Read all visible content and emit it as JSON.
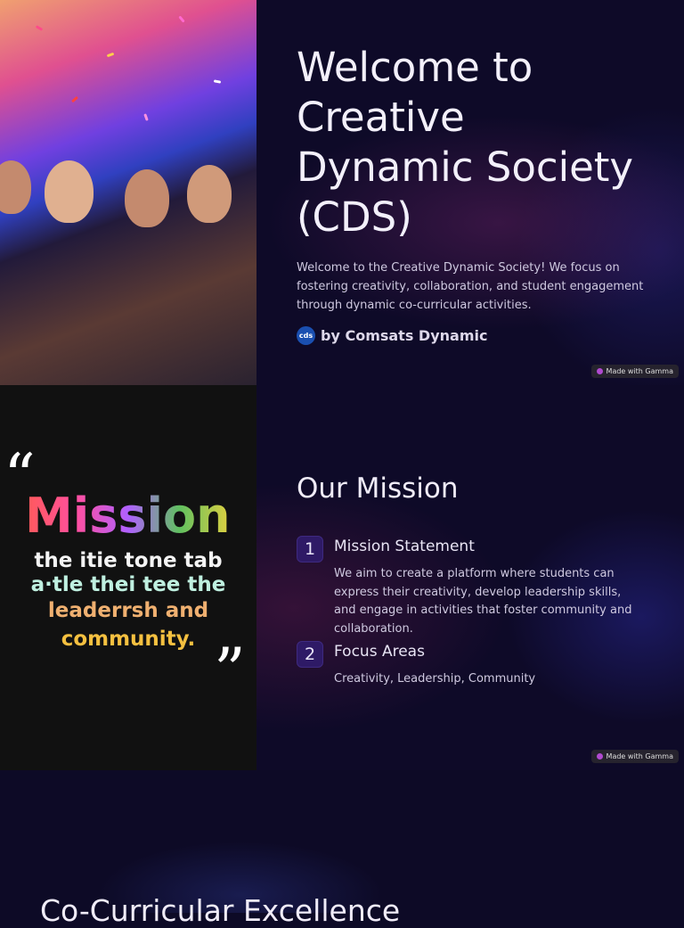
{
  "slide1": {
    "title": "Welcome to Creative Dynamic Society (CDS)",
    "description": "Welcome to the Creative Dynamic Society! We focus on fostering creativity, collaboration, and student engagement through dynamic co-curricular activities.",
    "author_avatar": "cds",
    "author": "by Comsats Dynamic",
    "badge": "Made with Gamma"
  },
  "slide2": {
    "image_text": {
      "title": "Mission",
      "lines": [
        "the itie tone tab",
        "a·tle thei tee the",
        "leaderrsh and",
        "community."
      ]
    },
    "title": "Our Mission",
    "items": [
      {
        "number": "1",
        "title": "Mission Statement",
        "body": "We aim to create a platform where students can express their creativity, develop leadership skills, and engage in activities that foster community and collaboration."
      },
      {
        "number": "2",
        "title": "Focus Areas",
        "body": "Creativity, Leadership, Community"
      }
    ],
    "badge": "Made with Gamma"
  },
  "slide3": {
    "title": "Co-Curricular Excellence"
  }
}
